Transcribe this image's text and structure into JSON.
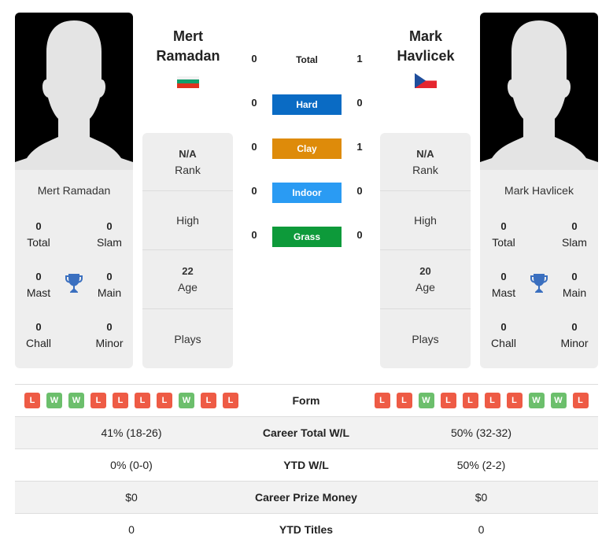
{
  "players": [
    {
      "name": "Mert Ramadan",
      "name_line1": "Mert",
      "name_line2": "Ramadan",
      "flag": "bulgaria-flag",
      "titles": {
        "total": "0",
        "total_label": "Total",
        "slam": "0",
        "slam_label": "Slam",
        "mast": "0",
        "mast_label": "Mast",
        "main": "0",
        "main_label": "Main",
        "chall": "0",
        "chall_label": "Chall",
        "minor": "0",
        "minor_label": "Minor"
      },
      "info": {
        "rank_value": "N/A",
        "rank_label": "Rank",
        "high_label": "High",
        "age_value": "22",
        "age_label": "Age",
        "plays_label": "Plays"
      },
      "form": [
        "L",
        "W",
        "W",
        "L",
        "L",
        "L",
        "L",
        "W",
        "L",
        "L"
      ]
    },
    {
      "name": "Mark Havlicek",
      "name_line1": "Mark",
      "name_line2": "Havlicek",
      "flag": "czech-flag",
      "titles": {
        "total": "0",
        "total_label": "Total",
        "slam": "0",
        "slam_label": "Slam",
        "mast": "0",
        "mast_label": "Mast",
        "main": "0",
        "main_label": "Main",
        "chall": "0",
        "chall_label": "Chall",
        "minor": "0",
        "minor_label": "Minor"
      },
      "info": {
        "rank_value": "N/A",
        "rank_label": "Rank",
        "high_label": "High",
        "age_value": "20",
        "age_label": "Age",
        "plays_label": "Plays"
      },
      "form": [
        "L",
        "L",
        "W",
        "L",
        "L",
        "L",
        "L",
        "W",
        "W",
        "L"
      ]
    }
  ],
  "h2h": {
    "total": {
      "label": "Total",
      "left": "0",
      "right": "1"
    },
    "surfaces": [
      {
        "label": "Hard",
        "left": "0",
        "right": "0",
        "color": "#0a6bc4"
      },
      {
        "label": "Clay",
        "left": "0",
        "right": "1",
        "color": "#de8b0a"
      },
      {
        "label": "Indoor",
        "left": "0",
        "right": "0",
        "color": "#2a9bf3"
      },
      {
        "label": "Grass",
        "left": "0",
        "right": "0",
        "color": "#0d9a3a"
      }
    ]
  },
  "stats": {
    "form_label": "Form",
    "rows": [
      {
        "label": "Career Total W/L",
        "left": "41% (18-26)",
        "right": "50% (32-32)"
      },
      {
        "label": "YTD W/L",
        "left": "0% (0-0)",
        "right": "50% (2-2)"
      },
      {
        "label": "Career Prize Money",
        "left": "$0",
        "right": "$0"
      },
      {
        "label": "YTD Titles",
        "left": "0",
        "right": "0"
      }
    ]
  },
  "colors": {
    "win": "#6cbf6c",
    "loss": "#ee5b45",
    "trophy": "#3a6fbf"
  }
}
